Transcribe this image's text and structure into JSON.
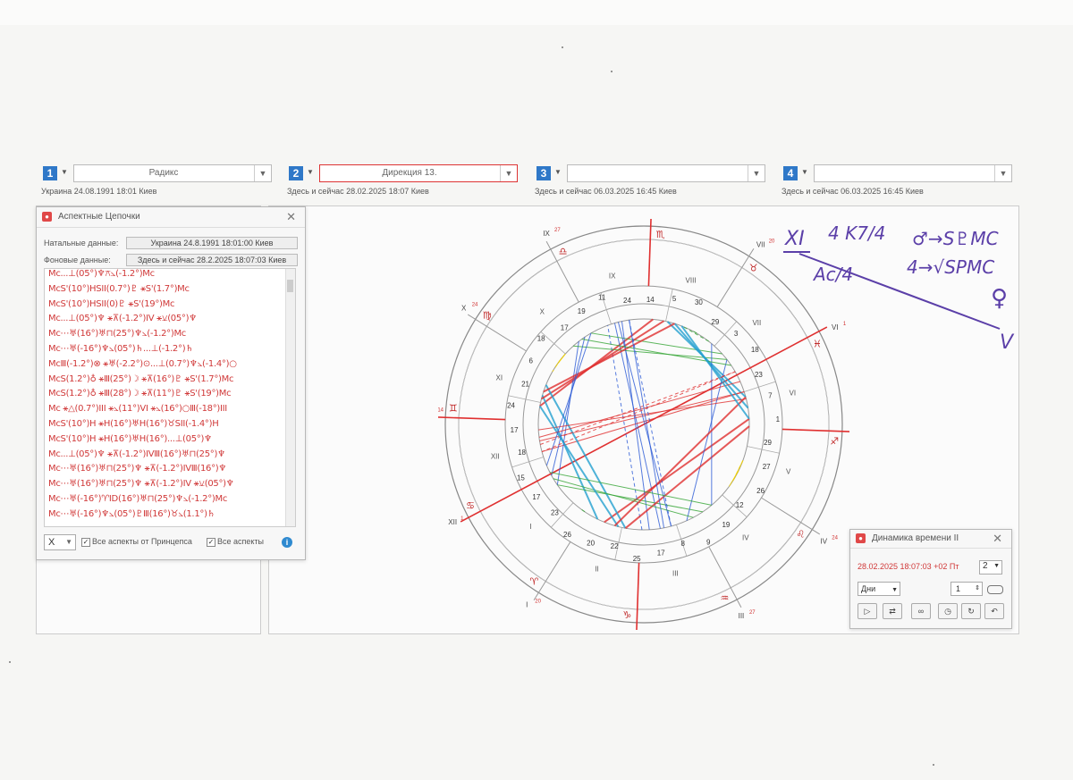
{
  "slots": [
    {
      "num": "1",
      "value": "Радикс",
      "subtitle": "Украина 24.08.1991 18:01 Киев"
    },
    {
      "num": "2",
      "value": "Дирекция 13.",
      "subtitle": "Здесь и сейчас 28.02.2025 18:07 Киев"
    },
    {
      "num": "3",
      "value": "",
      "subtitle": "Здесь и сейчас 06.03.2025 16:45 Киев"
    },
    {
      "num": "4",
      "value": "",
      "subtitle": "Здесь и сейчас 06.03.2025 16:45 Киев"
    }
  ],
  "aspect_window": {
    "title": "Аспектные Цепочки",
    "natal_label": "Натальные данные:",
    "natal_value": "Украина 24.8.1991 18:01:00 Киев",
    "bg_label": "Фоновые данные:",
    "bg_value": "Здесь и сейчас 28.2.2025 18:07:03 Киев",
    "chains": [
      "Mc...⊥(05°)♆⚻⦣(-1.2°)Mc",
      "McS'(10°)HSII(0.7°)♇ ⚹S'(1.7°)Mc",
      "McS'(10°)HSII(0)♇ ⚹S'(19°)Mc",
      "Mc...⊥(05°)♆ ⚹⊼(-1.2°)IV ⚹⚺(05°)♆",
      "Mc⋯♅(16°)♅⊓(25°)♆⦣(-1.2°)Mc",
      "Mc⋯♅(-16°)♆⦣(05°)♄...⊥(-1.2°)♄",
      "McⅢ(-1.2°)⊗ ⚹♅(-2.2°)⊙...⊥(0.7°)♆⦣(-1.4°)○",
      "McS(1.2°)♁ ⚹Ⅲ(25°)☽ ⚹⊼(16°)♇ ⚹S'(1.7°)Mc",
      "McS(1.2°)♁ ⚹Ⅲ(28°)☽ ⚹⊼(11°)♇ ⚹S'(19°)Mc",
      "Mc ⚹△(0.7°)III ⚹⦣(11°)VI ⚹⦣(16°)○Ⅲ(-18°)III",
      "McS'(10°)H ⚹H(16°)♅H(16°)♉SII(-1.4°)H",
      "McS'(10°)H ⚹H(16°)♅H(16°)...⊥(05°)♆",
      "Mc...⊥(05°)♆ ⚹⊼(-1.2°)IVⅢ(16°)♅⊓(25°)♆",
      "Mc⋯♅(16°)♅⊓(25°)♆ ⚹⊼(-1.2°)IVⅢ(16°)♆",
      "Mc⋯♅(16°)♅⊓(25°)♆ ⚹⊼(-1.2°)IV ⚹⚺(05°)♆",
      "Mc⋯♅(-16°)♈ID(16°)♅⊓(25°)♆⦣(-1.2°)Mc",
      "Mc⋯♅(-16°)♆⦣(05°)♇Ⅲ(16°)♉⦣(1.1°)♄"
    ],
    "filter_value": "X",
    "cb1_label": "Все аспекты от Принцепса",
    "cb2_label": "Все аспекты"
  },
  "dynamics_window": {
    "title": "Динамика времени II",
    "datetime": "28.02.2025  18:07:03 +02 Пт",
    "step_count": "2",
    "unit": "Дни",
    "step": "1"
  },
  "chart": {
    "house_labels_outer": [
      "VIII",
      "VII",
      "VI",
      "V",
      "IV",
      "III",
      "II",
      "I",
      "XII",
      "XI",
      "X",
      "IX"
    ],
    "house_labels_inner": [
      "VIII",
      "VII",
      "VI",
      "V",
      "IV",
      "III",
      "II",
      "I",
      "XII",
      "XI",
      "X",
      "IX"
    ],
    "outer_cusps": [
      {
        "label": "VIII"
      },
      {
        "label": "VII",
        "sup": "20"
      },
      {
        "label": "VI",
        "sup": "1"
      },
      {
        "label": "V",
        "sup": "14"
      },
      {
        "label": "IV",
        "sup": "24"
      },
      {
        "label": "III",
        "sup": "27"
      },
      {
        "label": "II",
        "sup": "14"
      },
      {
        "label": "I",
        "sup": "20"
      },
      {
        "label": "XII",
        "sup": "1"
      },
      {
        "label": "XI",
        "sup": "14"
      },
      {
        "label": "X",
        "sup": "24"
      },
      {
        "label": "IX",
        "sup": "27"
      }
    ],
    "degree_numbers": [
      "14",
      "5",
      "30",
      "29",
      "3",
      "18",
      "23",
      "7",
      "1",
      "29",
      "27",
      "26",
      "12",
      "19",
      "9",
      "8",
      "17",
      "25",
      "22",
      "20",
      "26",
      "23",
      "17",
      "15",
      "18",
      "17",
      "24",
      "21",
      "6",
      "18",
      "17",
      "19",
      "11",
      "24"
    ],
    "zodiac_glyphs": [
      "♏",
      "♉",
      "♓",
      "♐",
      "♌",
      "♒",
      "♑",
      "♈",
      "♋",
      "♊",
      "♍",
      "♎"
    ]
  },
  "annotation": {
    "line1": "XI",
    "line2": "4 K7/4",
    "line3": "♂→S♇MC",
    "line4": "Ac/4",
    "line5": "4→√SPMC",
    "planet": "♀",
    "roman": "V"
  }
}
